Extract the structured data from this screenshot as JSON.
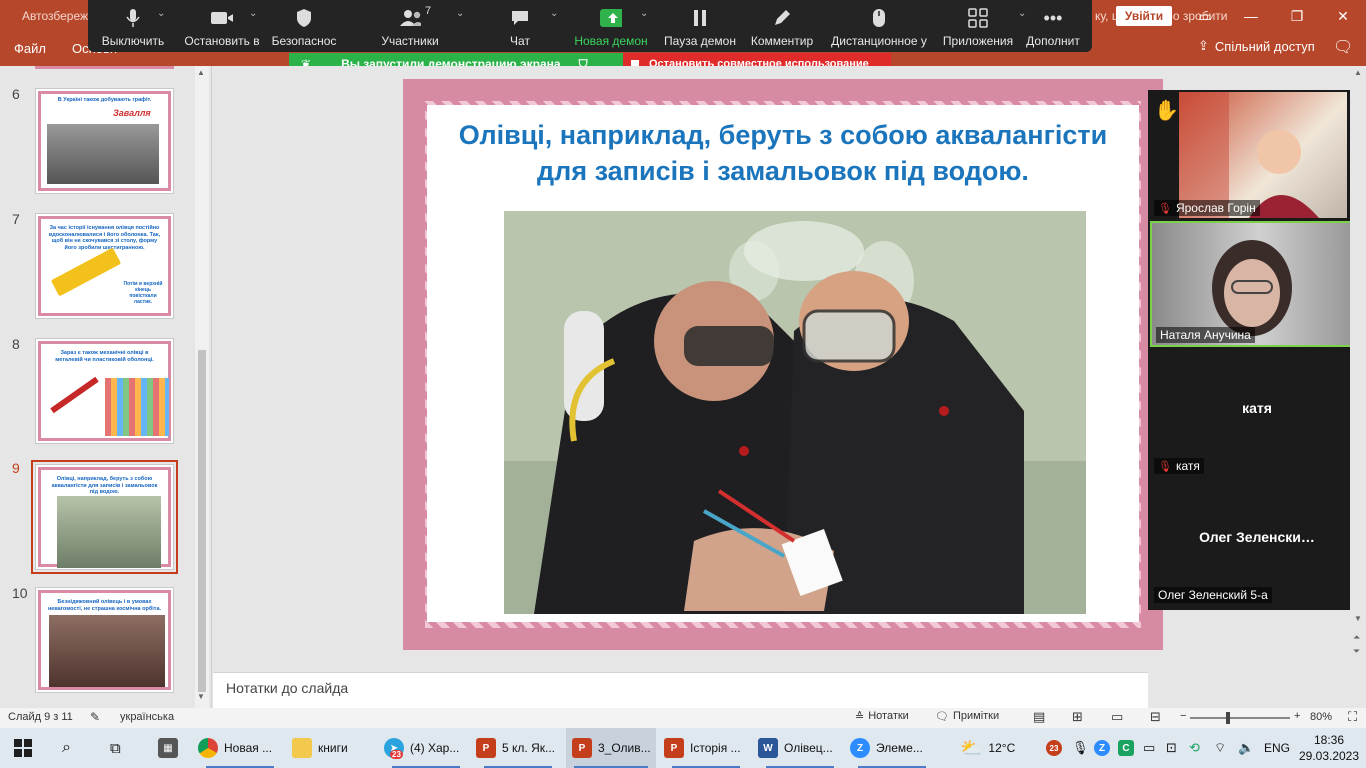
{
  "titlebar": {
    "autosave": "Автозбереж",
    "login_button": "Увійти",
    "right_tail": "ку, що потрібно зробити"
  },
  "ribbon": {
    "file_tab": "Файл",
    "home_tab": "Основн",
    "share_button": "Спільний доступ",
    "comment_icon": "comment-icon"
  },
  "zoom_toolbar": {
    "unmute": "Выключить",
    "stop_video": "Остановить в",
    "security": "Безопаснос",
    "participants": "Участники",
    "participants_count": "7",
    "chat": "Чат",
    "new_share": "Новая демон",
    "pause_share": "Пауза демон",
    "annotate": "Комментир",
    "remote_control": "Дистанционное у",
    "apps": "Приложения",
    "more": "Дополнит"
  },
  "share_banner": {
    "status": "Вы запустили демонстрацию экрана",
    "stop": "Остановить совместное использование",
    "status_color": "#2bb34a",
    "stop_color": "#e02b2b"
  },
  "slides_panel": {
    "items": [
      {
        "num": "6",
        "text": "В Україні також добувають графіт.",
        "label": "Завалля"
      },
      {
        "num": "7",
        "text": "За час історії існування олівця постійно вдосконалювалися і його оболонка. Так, щоб він не скочувався зі столу, форму його зробили шестигранною.",
        "label": "Потім в верхній кінець повісткали ластик."
      },
      {
        "num": "8",
        "text": "Зараз є також механічні олівці в металевій чи пластиковій оболонці.",
        "label": ""
      },
      {
        "num": "9",
        "text": "Олівці, наприклад, беруть з собою аквалангісти для записів і замальовок під водою.",
        "label": ""
      },
      {
        "num": "10",
        "text": "Безнідяжовний олівець і в умовах невагомості, не страшна космічна орбіта.",
        "label": ""
      }
    ]
  },
  "slide": {
    "title": "Олівці, наприклад, беруть з собою аквалангісти для записів і замальовок під водою."
  },
  "notes": {
    "placeholder": "Нотатки до слайда"
  },
  "status": {
    "slide_counter": "Слайд 9 з 11",
    "language": "українська",
    "notes_button": "Нотатки",
    "comments_button": "Примітки",
    "zoom_level": "80%",
    "zoom_minus": "−",
    "zoom_plus": "+"
  },
  "participants_video": [
    {
      "name": "Ярослав Горін",
      "muted": true,
      "hand_raised": true
    },
    {
      "name": "Наталя Анучина",
      "muted": false
    },
    {
      "name": "катя",
      "center": "катя",
      "muted": true
    },
    {
      "name": "Олег Зеленский 5-а",
      "center": "Олег  Зеленски…",
      "muted": false
    }
  ],
  "taskbar": {
    "items": [
      {
        "label": "Новая ...",
        "icon": "chrome-icon"
      },
      {
        "label": "книги",
        "icon": "folder-icon"
      },
      {
        "label": "(4) Хар...",
        "icon": "telegram-icon",
        "badge": "23"
      },
      {
        "label": "5 кл. Як...",
        "icon": "powerpoint-icon"
      },
      {
        "label": "3_Олив...",
        "icon": "powerpoint-icon"
      },
      {
        "label": "Історія ...",
        "icon": "powerpoint-icon"
      },
      {
        "label": "Олівец...",
        "icon": "word-icon"
      },
      {
        "label": "Элеме...",
        "icon": "zoom-icon"
      }
    ],
    "weather": "12°C",
    "tray_badge": "23",
    "language": "ENG",
    "time": "18:36",
    "date": "29.03.2023"
  }
}
